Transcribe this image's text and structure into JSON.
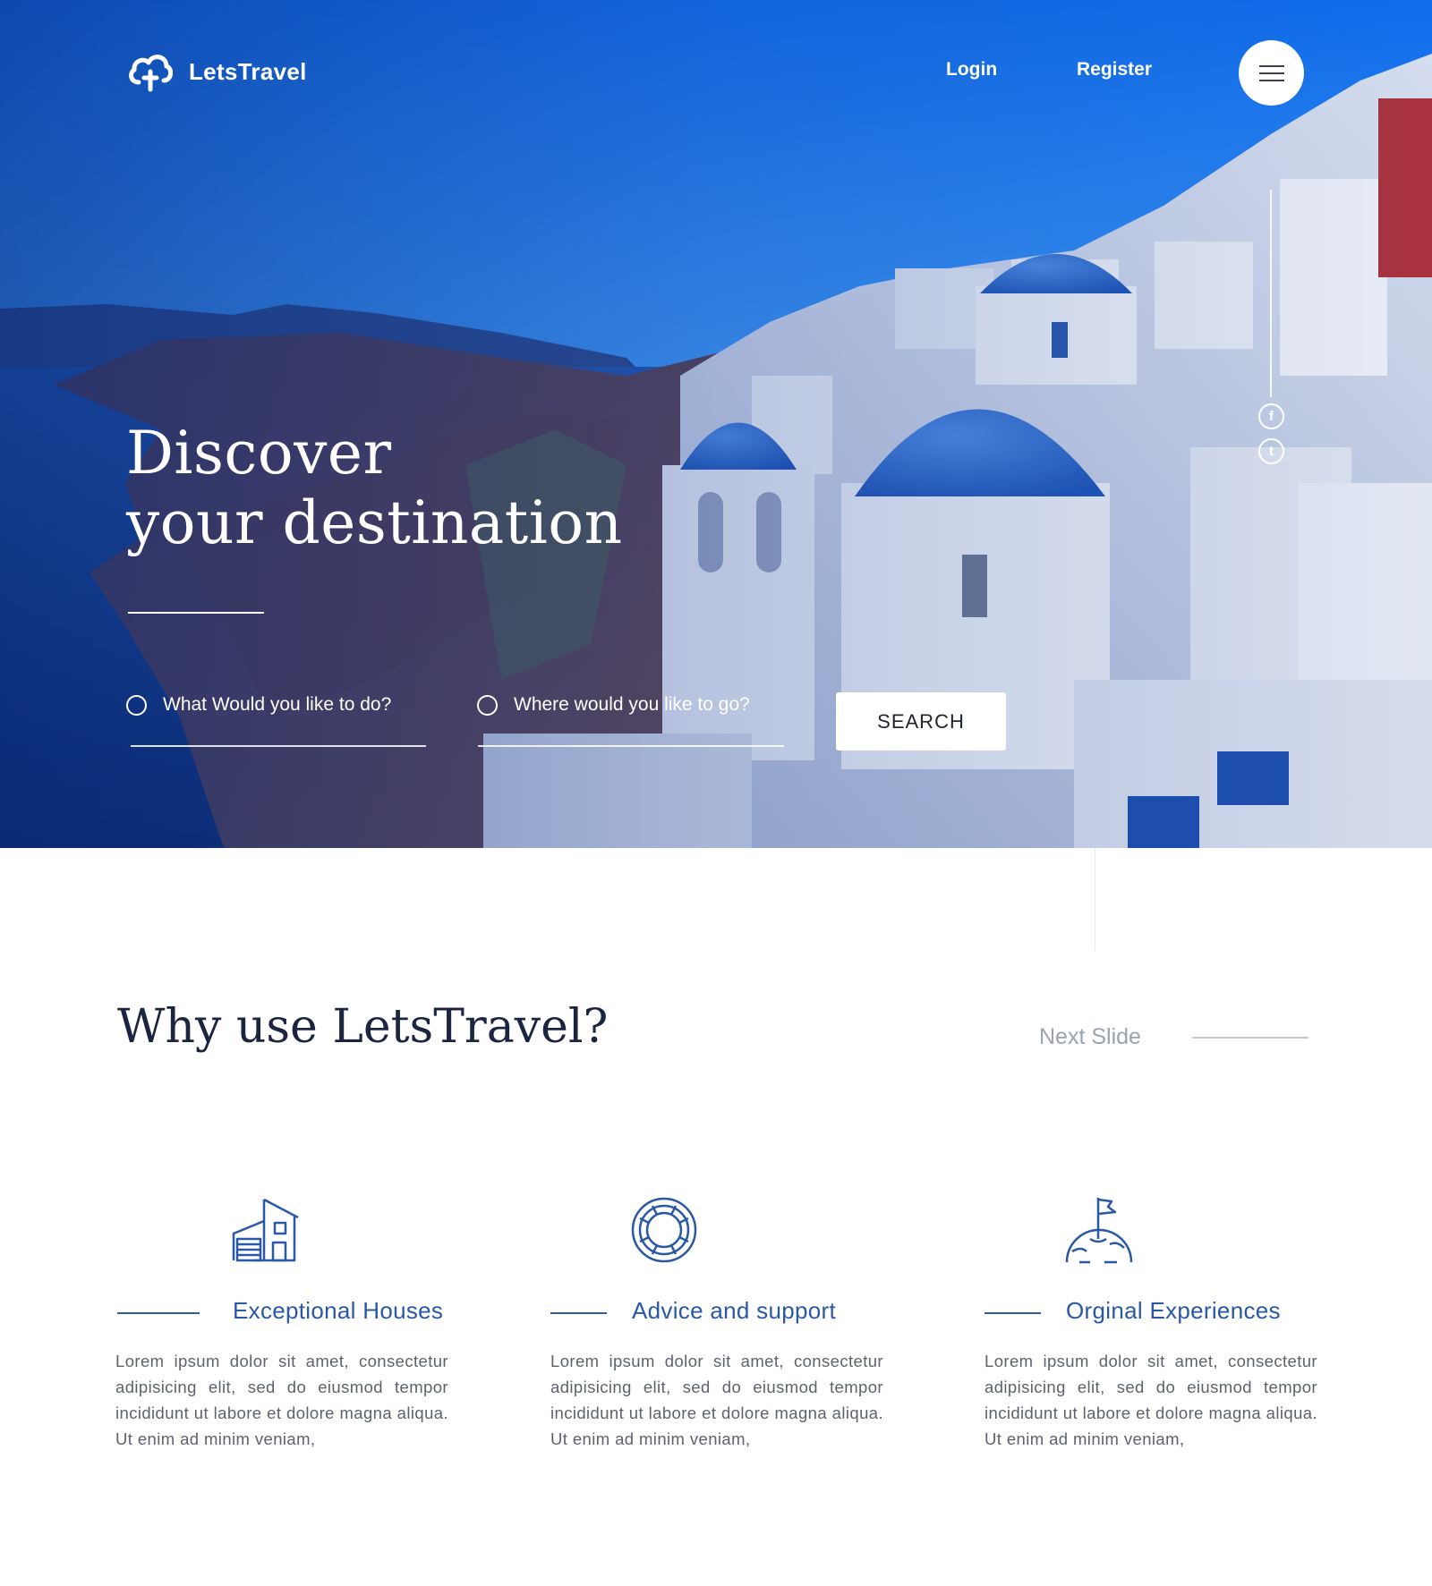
{
  "brand": {
    "name": "LetsTravel"
  },
  "nav": {
    "login": "Login",
    "register": "Register"
  },
  "hero": {
    "title_line1": "Discover",
    "title_line2": "your destination",
    "activity_placeholder": "What Would you like to do?",
    "destination_placeholder": "Where would you like to go?",
    "search_label": "SEARCH"
  },
  "social": {
    "facebook": "f",
    "twitter": "t"
  },
  "why": {
    "title": "Why use LetsTravel?",
    "next_slide": "Next Slide",
    "features": [
      {
        "title": "Exceptional Houses",
        "icon": "house-icon",
        "text": "Lorem ipsum dolor sit amet, consectetur adipisicing elit, sed do eiusmod tempor incididunt ut labore et dolore magna aliqua. Ut enim ad minim veniam,"
      },
      {
        "title": "Advice and support",
        "icon": "lifebuoy-icon",
        "text": "Lorem ipsum dolor sit amet, consectetur adipisicing elit, sed do eiusmod tempor incididunt ut labore et dolore magna aliqua. Ut enim ad minim veniam,"
      },
      {
        "title": "Orginal Experiences",
        "icon": "flag-globe-icon",
        "text": "Lorem ipsum dolor sit amet, consectetur adipisicing elit, sed do eiusmod tempor incididunt ut labore et dolore magna aliqua. Ut enim ad minim veniam,"
      }
    ]
  },
  "colors": {
    "accent": "#2a58a6",
    "hero_sky": "#1d7ef0",
    "heading": "#1b2540",
    "muted": "#9aa3b2"
  }
}
